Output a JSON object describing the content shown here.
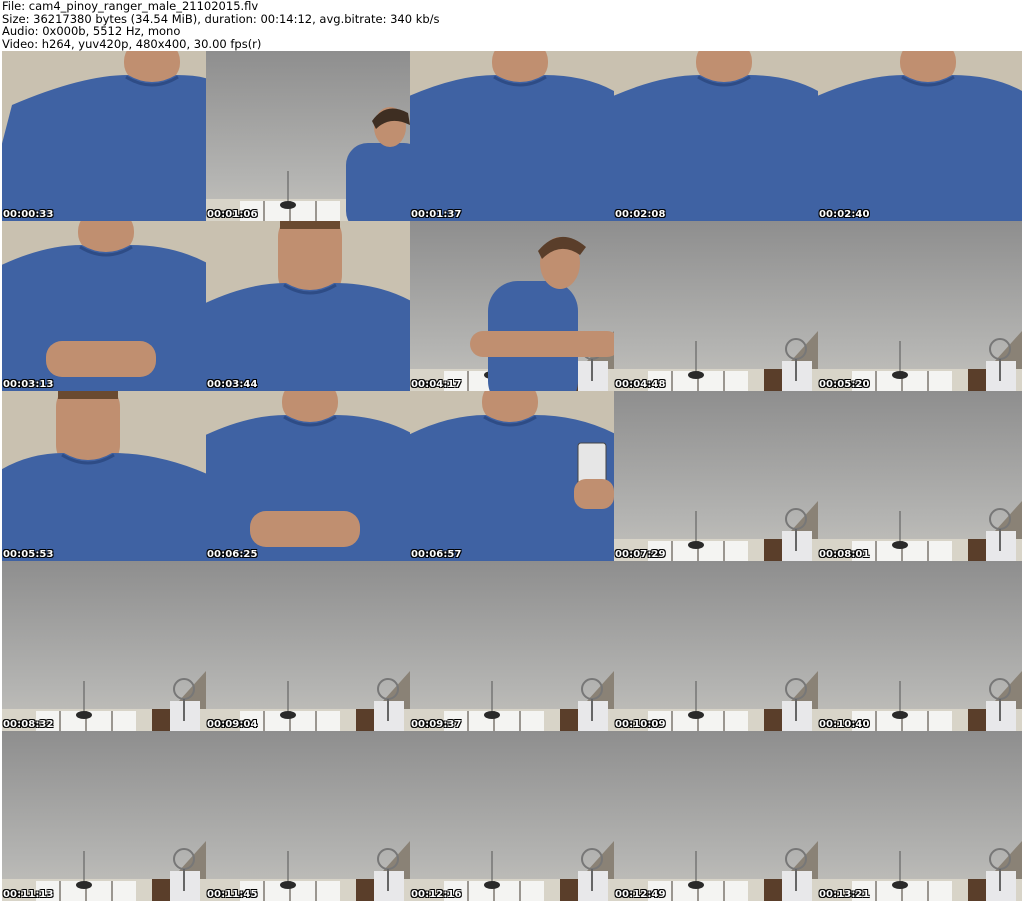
{
  "header": {
    "file_line": "File: cam4_pinoy_ranger_male_21102015.flv",
    "size_line": "Size: 36217380 bytes (34.54 MiB), duration: 00:14:12, avg.bitrate: 340 kb/s",
    "audio_line": "Audio: 0x000b, 5512 Hz, mono",
    "video_line": "Video: h264, yuv420p, 480x400, 30.00 fps(r)"
  },
  "thumbnails": [
    {
      "timestamp": "00:00:33",
      "scene": "torso-side"
    },
    {
      "timestamp": "00:01:06",
      "scene": "room-person-right"
    },
    {
      "timestamp": "00:01:37",
      "scene": "torso-center"
    },
    {
      "timestamp": "00:02:08",
      "scene": "torso-center"
    },
    {
      "timestamp": "00:02:40",
      "scene": "torso-center"
    },
    {
      "timestamp": "00:03:13",
      "scene": "torso-hands"
    },
    {
      "timestamp": "00:03:44",
      "scene": "torso-face"
    },
    {
      "timestamp": "00:04:17",
      "scene": "person-profile"
    },
    {
      "timestamp": "00:04:48",
      "scene": "room"
    },
    {
      "timestamp": "00:05:20",
      "scene": "room"
    },
    {
      "timestamp": "00:05:53",
      "scene": "face-torso"
    },
    {
      "timestamp": "00:06:25",
      "scene": "torso-hands"
    },
    {
      "timestamp": "00:06:57",
      "scene": "torso-phone"
    },
    {
      "timestamp": "00:07:29",
      "scene": "room"
    },
    {
      "timestamp": "00:08:01",
      "scene": "room"
    },
    {
      "timestamp": "00:08:32",
      "scene": "room"
    },
    {
      "timestamp": "00:09:04",
      "scene": "room"
    },
    {
      "timestamp": "00:09:37",
      "scene": "room"
    },
    {
      "timestamp": "00:10:09",
      "scene": "room"
    },
    {
      "timestamp": "00:10:40",
      "scene": "room"
    },
    {
      "timestamp": "00:11:13",
      "scene": "room"
    },
    {
      "timestamp": "00:11:45",
      "scene": "room"
    },
    {
      "timestamp": "00:12:16",
      "scene": "room"
    },
    {
      "timestamp": "00:12:49",
      "scene": "room"
    },
    {
      "timestamp": "00:13:21",
      "scene": "room"
    }
  ],
  "colors": {
    "shirt": "#3f62a3",
    "ceiling": "#9a9a9a",
    "skin": "#c08f70"
  }
}
